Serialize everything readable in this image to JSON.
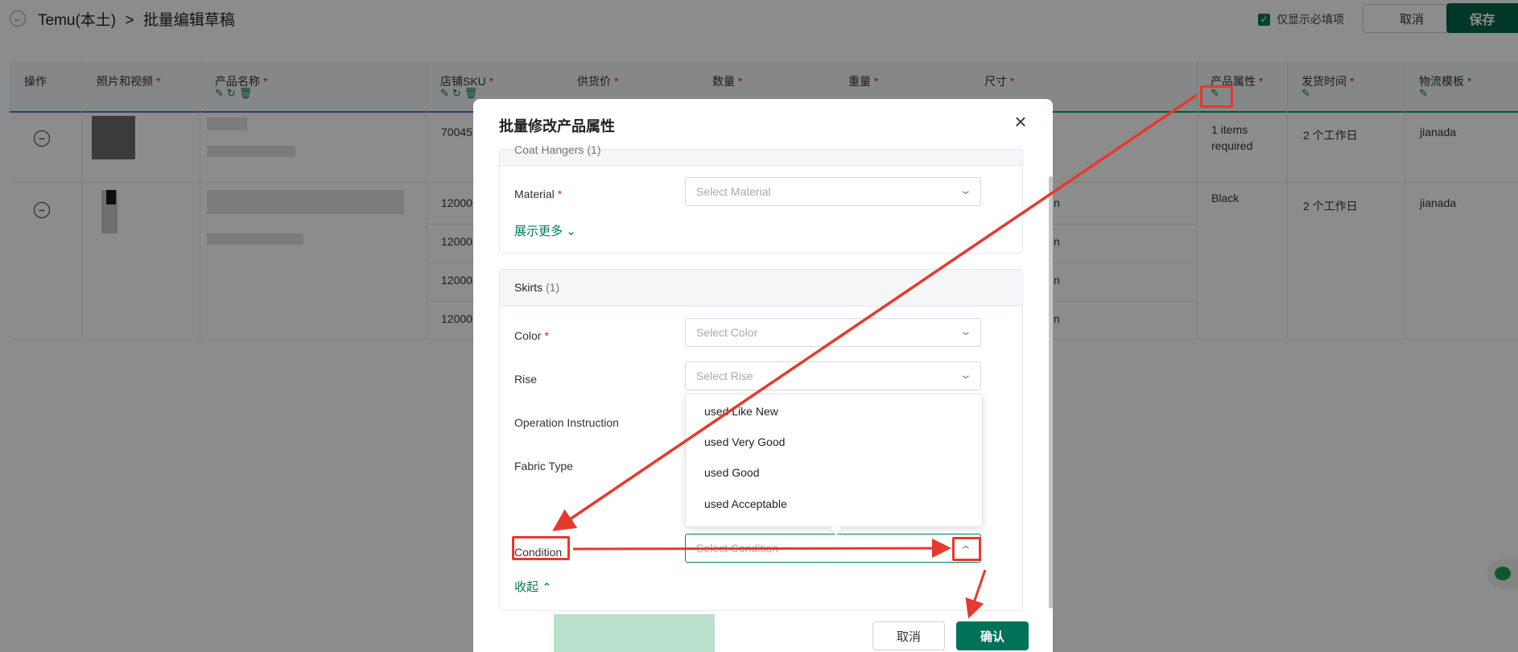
{
  "header": {
    "back_icon": "arrow-left-icon",
    "breadcrumb_root": "Temu(本土)",
    "separator": ">",
    "title": "批量编辑草稿",
    "only_required_label": "仅显示必填项",
    "only_required_checked": true,
    "cancel_label": "取消",
    "save_label": "保存"
  },
  "table": {
    "columns": [
      "操作",
      "照片和视频",
      "产品名称",
      "店铺SKU",
      "供货价",
      "数量",
      "重量",
      "尺寸",
      "产品属性",
      "发货时间",
      "物流模板"
    ],
    "rows": [
      {
        "sku": "70045",
        "attribute": "1 items required",
        "ship_time": "2 个工作日",
        "logistics": "jianada"
      },
      {
        "sku": "12000",
        "attribute": "Black",
        "ship_time": "2 个工作日",
        "logistics": "jianada"
      }
    ],
    "sub_skus": [
      "12000",
      "12000",
      "12000"
    ],
    "size_suffix": "n"
  },
  "modal": {
    "title": "批量修改产品属性",
    "close_icon": "close-icon",
    "sections": [
      {
        "title": "Coat Hangers",
        "count": "(1)",
        "fields": [
          {
            "label": "Material",
            "required": true,
            "placeholder": "Select Material"
          }
        ],
        "expand_label": "展示更多"
      },
      {
        "title": "Skirts",
        "count": "(1)",
        "fields": [
          {
            "label": "Color",
            "required": true,
            "placeholder": "Select Color"
          },
          {
            "label": "Rise",
            "required": false,
            "placeholder": "Select Rise"
          },
          {
            "label": "Operation Instruction",
            "required": false,
            "placeholder": ""
          },
          {
            "label": "Fabric Type",
            "required": false,
            "placeholder": ""
          },
          {
            "label": "Condition",
            "required": false,
            "placeholder": "Select Condition"
          }
        ],
        "collapse_label": "收起"
      }
    ],
    "condition_options": [
      "used Like New",
      "used Very Good",
      "used Good",
      "used Acceptable"
    ],
    "cancel_label": "取消",
    "confirm_label": "确认"
  },
  "colors": {
    "brand": "#00644a",
    "required": "#e02020",
    "annotation": "#e6392e"
  }
}
